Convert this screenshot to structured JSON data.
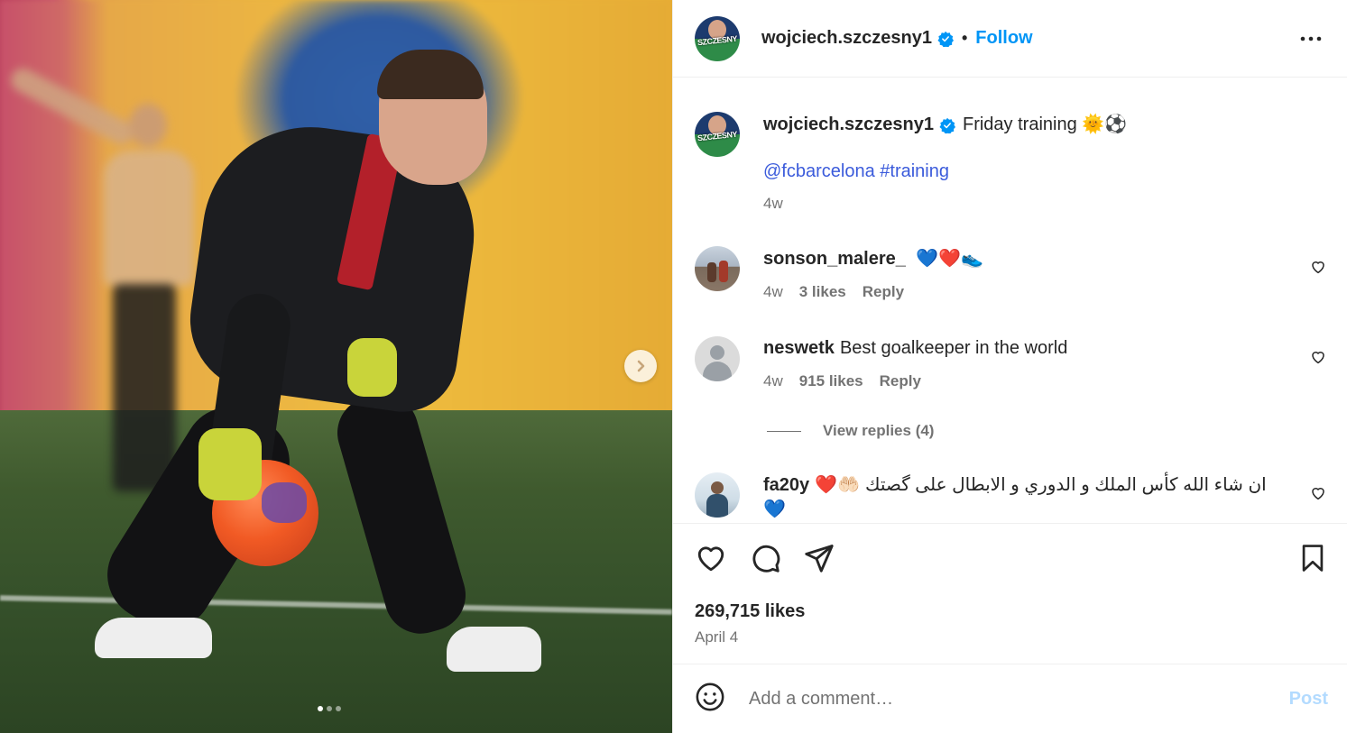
{
  "post": {
    "username": "wojciech.szczesny1",
    "follow_label": "Follow",
    "separator": "•",
    "avatar_text": "SZCZESNY",
    "media": {
      "slide_count": 3,
      "active_slide": 1
    }
  },
  "caption": {
    "username": "wojciech.szczesny1",
    "text": "Friday training",
    "emoji": "🌞⚽",
    "mention": "@fcbarcelona",
    "hashtag": "#training",
    "time": "4w"
  },
  "comments": [
    {
      "username": "sonson_malere_",
      "text": "💙❤️👟",
      "time": "4w",
      "likes": "3 likes",
      "reply": "Reply"
    },
    {
      "username": "neswetk",
      "text": "Best goalkeeper in the world",
      "time": "4w",
      "likes": "915 likes",
      "reply": "Reply",
      "view_replies": "View replies (4)"
    },
    {
      "username": "fa20y",
      "text": "ان شاء الله كأس الملك و الدوري و الابطال على گصتك",
      "emoji_lead": "❤️🤲🏻",
      "emoji_trail": "💙"
    }
  ],
  "stats": {
    "likes": "269,715 likes",
    "date": "April 4"
  },
  "composer": {
    "placeholder": "Add a comment…",
    "post_label": "Post"
  },
  "colors": {
    "accent": "#0095f6",
    "link": "#3b5bdb",
    "muted": "#737373",
    "post_disabled": "#b3dbff"
  }
}
